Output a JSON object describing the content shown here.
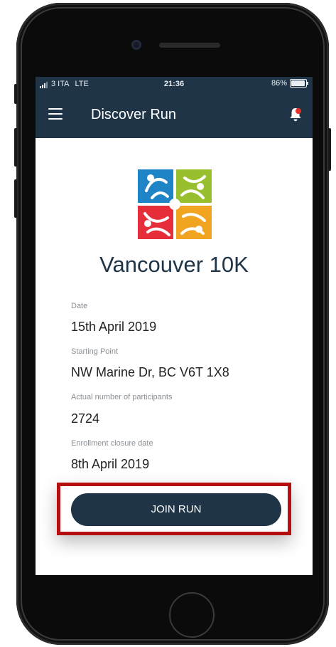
{
  "status_bar": {
    "carrier": "3 ITA",
    "network": "LTE",
    "time": "21:36",
    "battery": "86%"
  },
  "app_bar": {
    "title": "Discover Run",
    "menu_icon": "hamburger-menu-icon",
    "notification_icon": "bell-icon",
    "notification_badge_color": "#e5302a"
  },
  "event": {
    "title": "Vancouver 10K",
    "logo_icon": "run-logo-icon",
    "fields": [
      {
        "label": "Date",
        "value": "15th April 2019"
      },
      {
        "label": "Starting Point",
        "value": "NW Marine Dr, BC V6T 1X8"
      },
      {
        "label": "Actual number of participants",
        "value": "2724"
      },
      {
        "label": "Enrollment closure date",
        "value": "8th April 2019"
      }
    ]
  },
  "actions": {
    "join_label": "JOIN RUN"
  },
  "colors": {
    "primary": "#1f3446",
    "highlight_border": "#b50f12",
    "logo_blue": "#1f84c6",
    "logo_green": "#97bf2e",
    "logo_red": "#e52e3a",
    "logo_orange": "#f0a41f"
  }
}
